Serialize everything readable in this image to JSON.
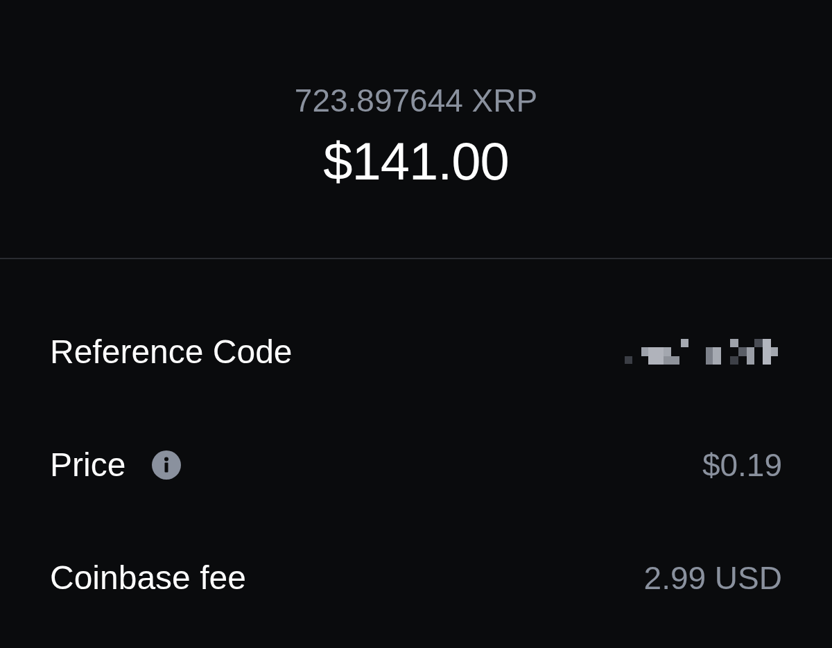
{
  "header": {
    "crypto_amount": "723.897644 XRP",
    "fiat_amount": "$141.00"
  },
  "details": [
    {
      "label": "Reference Code",
      "kind": "redacted",
      "info": false
    },
    {
      "label": "Price",
      "kind": "text",
      "value": "$0.19",
      "info": true
    },
    {
      "label": "Coinbase fee",
      "kind": "text",
      "value": "2.99 USD",
      "info": false
    }
  ]
}
